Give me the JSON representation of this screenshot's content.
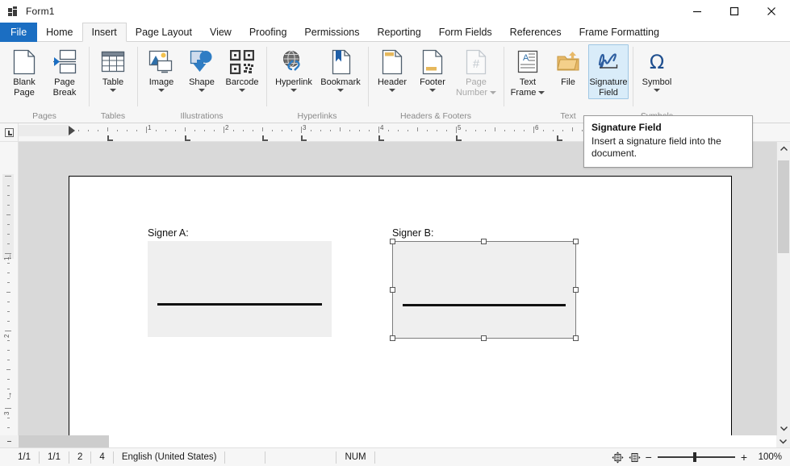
{
  "window": {
    "title": "Form1",
    "app_icon": "app-window-icon",
    "minimize": "minimize-icon",
    "maximize": "maximize-icon",
    "close": "close-icon"
  },
  "ribbon_tabs": [
    {
      "label": "File",
      "state": "file"
    },
    {
      "label": "Home",
      "state": "normal"
    },
    {
      "label": "Insert",
      "state": "active"
    },
    {
      "label": "Page Layout",
      "state": "normal"
    },
    {
      "label": "View",
      "state": "normal"
    },
    {
      "label": "Proofing",
      "state": "normal"
    },
    {
      "label": "Permissions",
      "state": "normal"
    },
    {
      "label": "Reporting",
      "state": "normal"
    },
    {
      "label": "Form Fields",
      "state": "normal"
    },
    {
      "label": "References",
      "state": "normal"
    },
    {
      "label": "Frame Formatting",
      "state": "normal"
    }
  ],
  "ribbon_groups": [
    {
      "name": "Pages",
      "label": "Pages",
      "buttons": [
        {
          "label": "Blank\nPage",
          "line1": "Blank",
          "line2": "Page",
          "icon": "blank-page-icon",
          "dropdown": false,
          "disabled": false
        },
        {
          "label": "Page\nBreak",
          "line1": "Page",
          "line2": "Break",
          "icon": "page-break-icon",
          "dropdown": false,
          "disabled": false
        }
      ]
    },
    {
      "name": "Tables",
      "label": "Tables",
      "buttons": [
        {
          "label": "Table",
          "line1": "Table",
          "line2": "",
          "icon": "table-icon",
          "dropdown": true,
          "disabled": false
        }
      ]
    },
    {
      "name": "Illustrations",
      "label": "Illustrations",
      "buttons": [
        {
          "label": "Image",
          "line1": "Image",
          "line2": "",
          "icon": "image-icon",
          "dropdown": true,
          "disabled": false
        },
        {
          "label": "Shape",
          "line1": "Shape",
          "line2": "",
          "icon": "shape-icon",
          "dropdown": true,
          "disabled": false
        },
        {
          "label": "Barcode",
          "line1": "Barcode",
          "line2": "",
          "icon": "barcode-icon",
          "dropdown": true,
          "disabled": false
        }
      ]
    },
    {
      "name": "Hyperlinks",
      "label": "Hyperlinks",
      "buttons": [
        {
          "label": "Hyperlink",
          "line1": "Hyperlink",
          "line2": "",
          "icon": "hyperlink-icon",
          "dropdown": true,
          "disabled": false
        },
        {
          "label": "Bookmark",
          "line1": "Bookmark",
          "line2": "",
          "icon": "bookmark-icon",
          "dropdown": true,
          "disabled": false
        }
      ]
    },
    {
      "name": "Headers & Footers",
      "label": "Headers & Footers",
      "buttons": [
        {
          "label": "Header",
          "line1": "Header",
          "line2": "",
          "icon": "header-icon",
          "dropdown": true,
          "disabled": false
        },
        {
          "label": "Footer",
          "line1": "Footer",
          "line2": "",
          "icon": "footer-icon",
          "dropdown": true,
          "disabled": false
        },
        {
          "label": "Page Number",
          "line1": "Page",
          "line2": "Number",
          "icon": "page-number-icon",
          "dropdown": true,
          "disabled": true
        }
      ]
    },
    {
      "name": "Text",
      "label": "Text",
      "buttons": [
        {
          "label": "Text Frame",
          "line1": "Text",
          "line2": "Frame",
          "icon": "text-frame-icon",
          "dropdown": true,
          "disabled": false
        },
        {
          "label": "File",
          "line1": "File",
          "line2": "",
          "icon": "file-import-icon",
          "dropdown": false,
          "disabled": false
        },
        {
          "label": "Signature Field",
          "line1": "Signature",
          "line2": "Field",
          "icon": "signature-field-icon",
          "dropdown": false,
          "disabled": false,
          "selected": true
        }
      ]
    },
    {
      "name": "Symbols",
      "label": "Symbols",
      "buttons": [
        {
          "label": "Symbol",
          "line1": "Symbol",
          "line2": "",
          "icon": "symbol-omega-icon",
          "dropdown": true,
          "disabled": false
        }
      ]
    }
  ],
  "tooltip": {
    "title": "Signature Field",
    "body": "Insert a signature field into the document."
  },
  "ruler": {
    "horizontal_numbers": [
      "1",
      "1",
      "2",
      "3",
      "4",
      "5"
    ],
    "vertical_numbers": [
      "1",
      "2"
    ],
    "tab_stop_marker": "left-tab-stop"
  },
  "document": {
    "signature_blocks": [
      {
        "label": "Signer A:",
        "selected": false,
        "name": "signature-field-a"
      },
      {
        "label": "Signer B:",
        "selected": true,
        "name": "signature-field-b"
      }
    ]
  },
  "statusbar": {
    "cells": [
      "1/1",
      "1/1",
      "2",
      "4",
      "English (United States)",
      "",
      "",
      "NUM"
    ],
    "zoom_percent": "100%",
    "zoom_out": "−",
    "zoom_in": "+",
    "fit_page_icon": "fit-page-icon",
    "fit_width_icon": "fit-width-icon"
  },
  "colors": {
    "accent": "#1b6ec2",
    "ribbon_bg": "#f6f6f6",
    "selected_button_bg": "#d9ecf9",
    "selected_button_border": "#9fc7e4",
    "canvas_bg": "#d9d9d9",
    "page_bg": "#ffffff",
    "sig_field_bg": "#efefef",
    "sig_line": "#111111"
  }
}
